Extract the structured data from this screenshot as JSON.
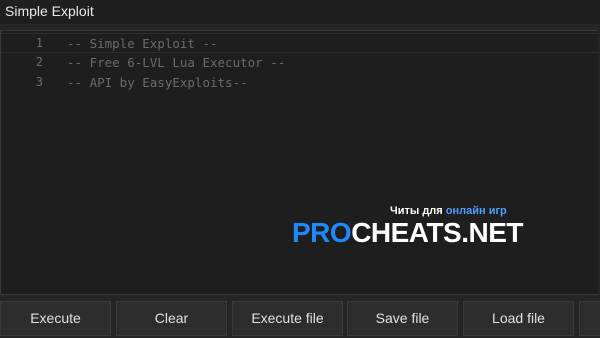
{
  "window": {
    "title": "Simple Exploit"
  },
  "editor": {
    "lines": [
      {
        "number": "1",
        "text": "-- Simple Exploit --"
      },
      {
        "number": "2",
        "text": "-- Free 6-LVL Lua Executor --"
      },
      {
        "number": "3",
        "text": "-- API by EasyExploits--"
      }
    ]
  },
  "watermark": {
    "subtitle_white": "Читы для",
    "subtitle_blue": "онлайн игр",
    "brand_blue": "PRO",
    "brand_white": "CHEATS.NET"
  },
  "buttons": {
    "execute": "Execute",
    "clear": "Clear",
    "execute_file": "Execute file",
    "save_file": "Save file",
    "load_file": "Load file"
  },
  "colors": {
    "background": "#252526",
    "editor_bg": "#1e1e1e",
    "comment_text": "#6a6a6a",
    "watermark_blue": "#1e88ff"
  }
}
